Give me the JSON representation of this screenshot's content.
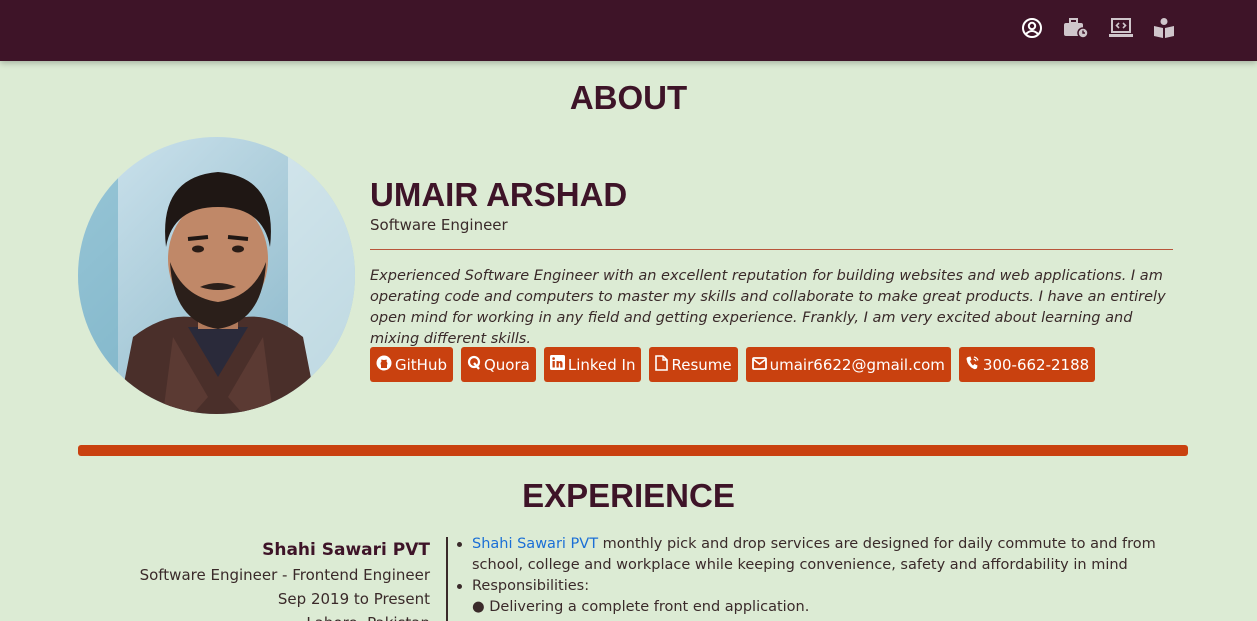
{
  "nav": {
    "icons": [
      "user-circle-icon",
      "briefcase-clock-icon",
      "laptop-code-icon",
      "book-reader-icon"
    ],
    "background": "#3e1428"
  },
  "about": {
    "title": "ABOUT",
    "name": "UMAIR ARSHAD",
    "role": "Software Engineer",
    "bio": "Experienced Software Engineer with an excellent reputation for building websites and web applications. I am operating code and computers to master my skills and collaborate to make great products. I have an entirely open mind for working in any field and getting experience. Frankly, I am very excited about learning and mixing different skills.",
    "links": [
      {
        "label": "GitHub",
        "icon": "github-icon"
      },
      {
        "label": "Quora",
        "icon": "quora-icon"
      },
      {
        "label": "Linked In",
        "icon": "linkedin-icon"
      },
      {
        "label": "Resume",
        "icon": "file-icon"
      },
      {
        "label": "umair6622@gmail.com",
        "icon": "envelope-icon"
      },
      {
        "label": "300-662-2188",
        "icon": "phone-icon"
      }
    ]
  },
  "experience": {
    "title": "EXPERIENCE",
    "company": "Shahi Sawari PVT",
    "position": "Software Engineer - Frontend Engineer",
    "period": "Sep 2019 to Present",
    "location": "Lahore, Pakistan",
    "company_link": "Shahi Sawari PVT",
    "description": " monthly pick and drop services are designed for daily commute to and from school, college and workplace while keeping convenience, safety and affordability in mind",
    "responsibilities_label": "Responsibilities:",
    "duty_1": "● Delivering a complete front end application."
  },
  "colors": {
    "accent": "#c9410f",
    "primary": "#3e1428",
    "background": "#dcebd4",
    "link": "#1b6fd6"
  }
}
